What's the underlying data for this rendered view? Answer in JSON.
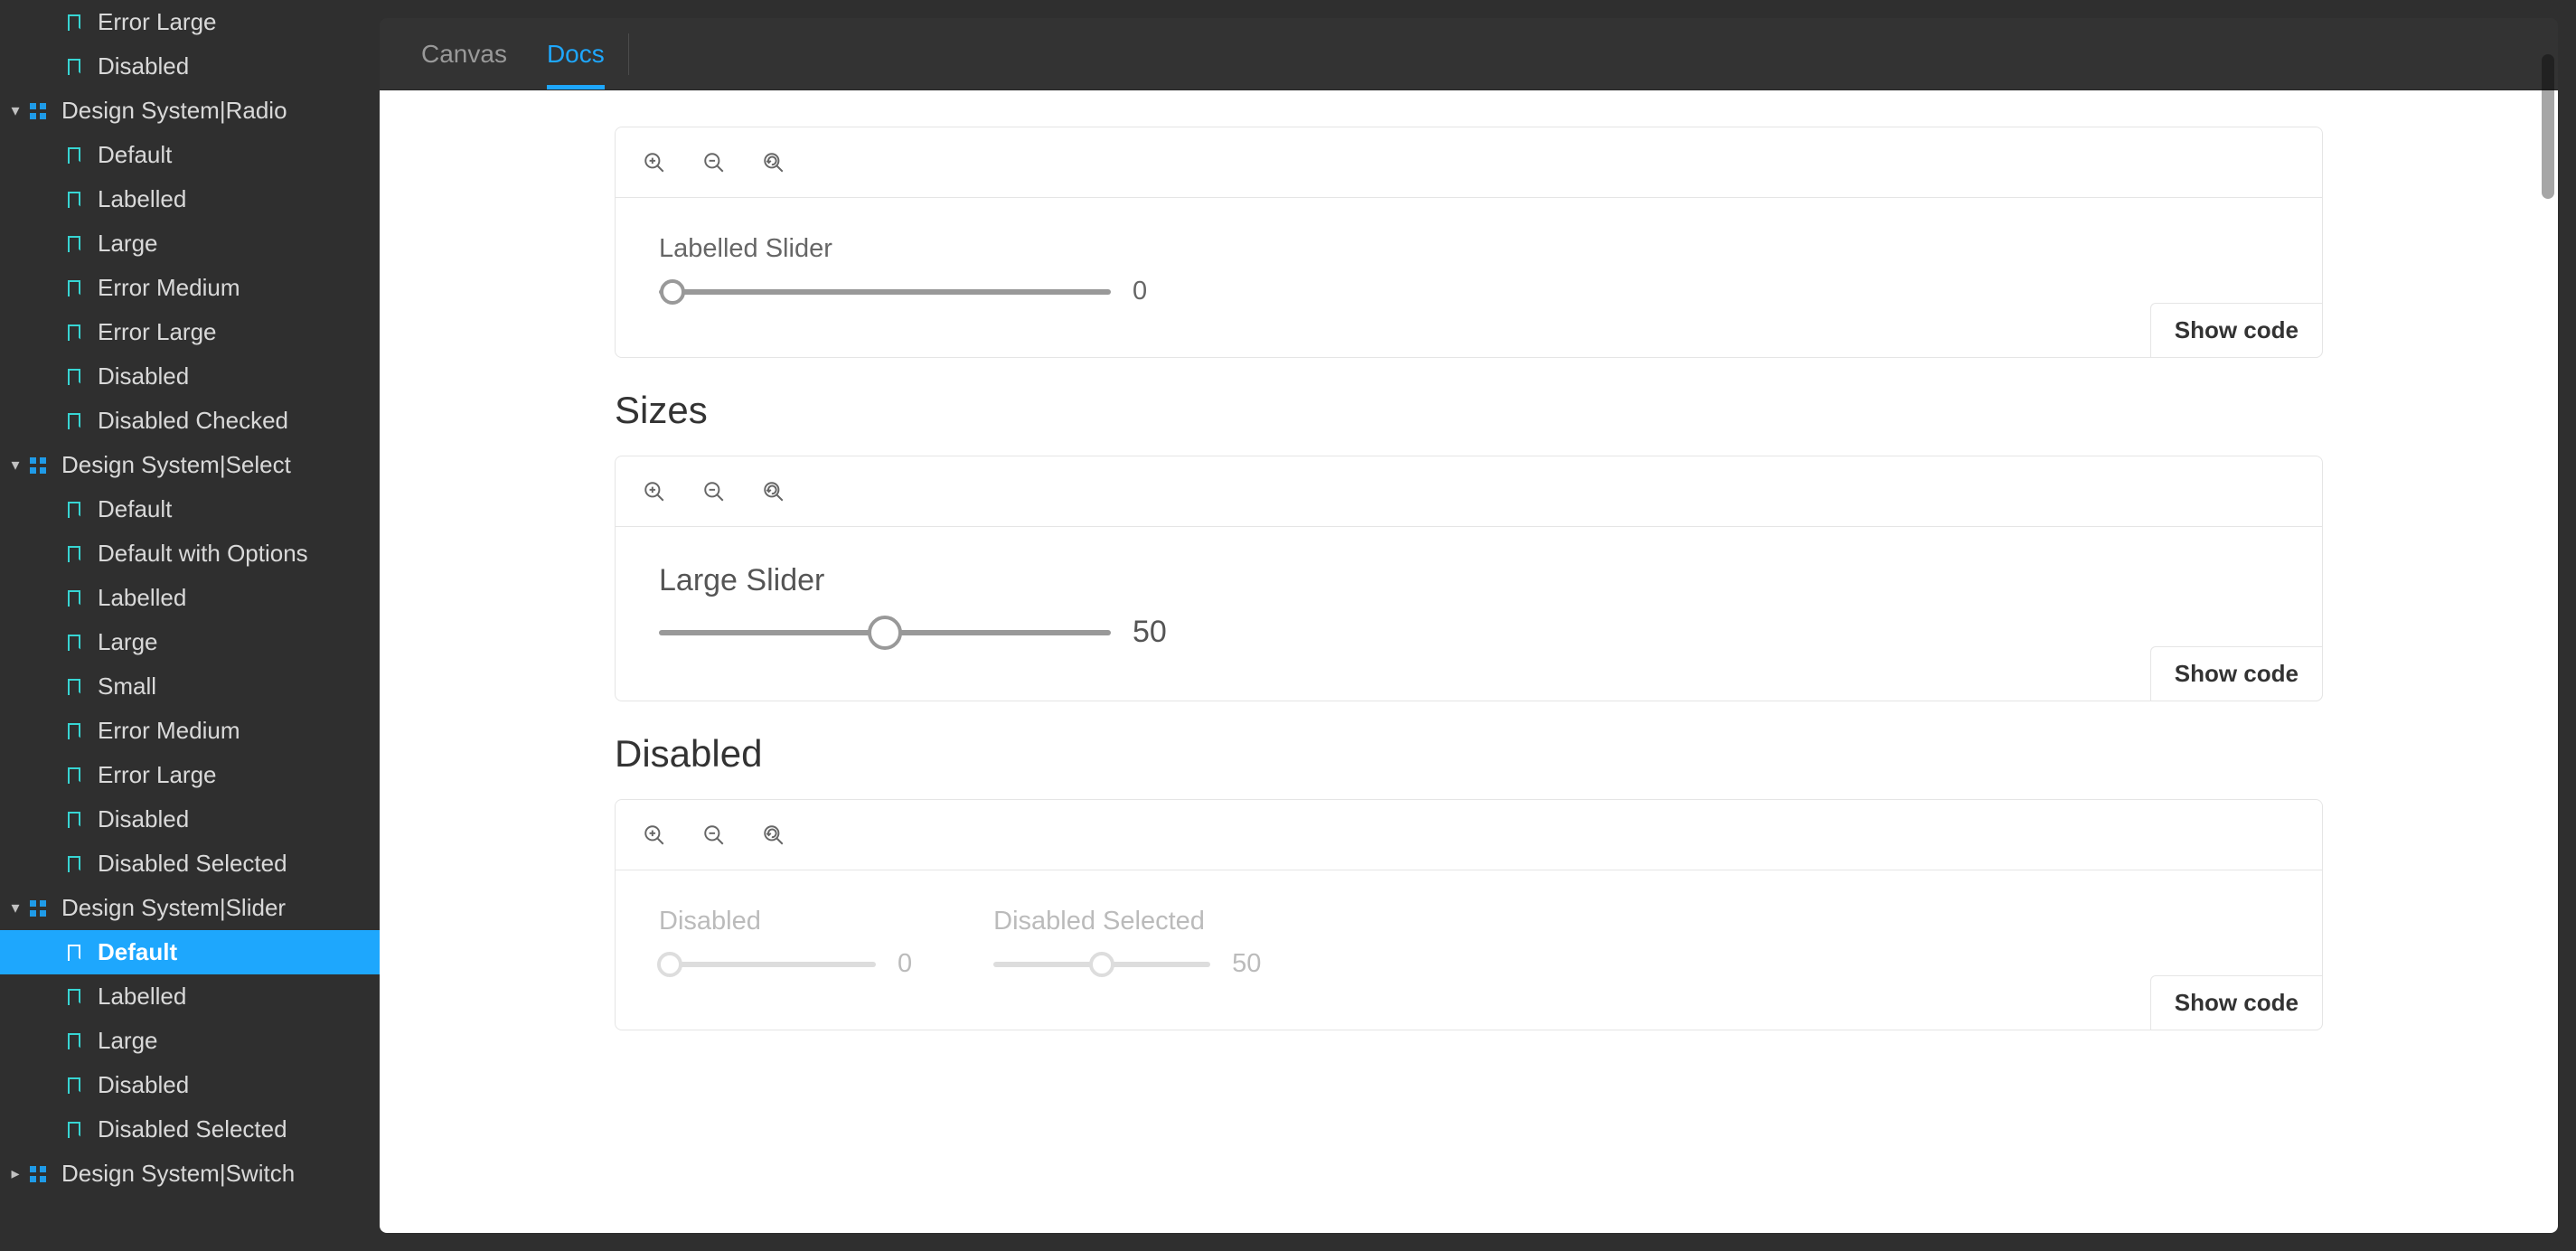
{
  "tabs": {
    "canvas": "Canvas",
    "docs": "Docs"
  },
  "sidebar": [
    {
      "type": "story",
      "label": "Error Large"
    },
    {
      "type": "story",
      "label": "Disabled"
    },
    {
      "type": "group",
      "label": "Design System|Radio",
      "expanded": true
    },
    {
      "type": "story",
      "label": "Default"
    },
    {
      "type": "story",
      "label": "Labelled"
    },
    {
      "type": "story",
      "label": "Large"
    },
    {
      "type": "story",
      "label": "Error Medium"
    },
    {
      "type": "story",
      "label": "Error Large"
    },
    {
      "type": "story",
      "label": "Disabled"
    },
    {
      "type": "story",
      "label": "Disabled Checked"
    },
    {
      "type": "group",
      "label": "Design System|Select",
      "expanded": true
    },
    {
      "type": "story",
      "label": "Default"
    },
    {
      "type": "story",
      "label": "Default with Options"
    },
    {
      "type": "story",
      "label": "Labelled"
    },
    {
      "type": "story",
      "label": "Large"
    },
    {
      "type": "story",
      "label": "Small"
    },
    {
      "type": "story",
      "label": "Error Medium"
    },
    {
      "type": "story",
      "label": "Error Large"
    },
    {
      "type": "story",
      "label": "Disabled"
    },
    {
      "type": "story",
      "label": "Disabled Selected"
    },
    {
      "type": "group",
      "label": "Design System|Slider",
      "expanded": true
    },
    {
      "type": "story",
      "label": "Default",
      "selected": true
    },
    {
      "type": "story",
      "label": "Labelled"
    },
    {
      "type": "story",
      "label": "Large"
    },
    {
      "type": "story",
      "label": "Disabled"
    },
    {
      "type": "story",
      "label": "Disabled Selected"
    },
    {
      "type": "group",
      "label": "Design System|Switch",
      "expanded": false
    }
  ],
  "sections": {
    "labelled": {
      "slider": {
        "label": "Labelled Slider",
        "value": "0",
        "pos": 0,
        "trackWidth": 500
      }
    },
    "sizes": {
      "heading": "Sizes",
      "slider": {
        "label": "Large Slider",
        "value": "50",
        "pos": 50,
        "trackWidth": 500
      }
    },
    "disabled": {
      "heading": "Disabled",
      "sliders": [
        {
          "label": "Disabled",
          "value": "0",
          "pos": 0,
          "trackWidth": 240
        },
        {
          "label": "Disabled Selected",
          "value": "50",
          "pos": 50,
          "trackWidth": 240
        }
      ]
    }
  },
  "buttons": {
    "showCode": "Show code"
  }
}
